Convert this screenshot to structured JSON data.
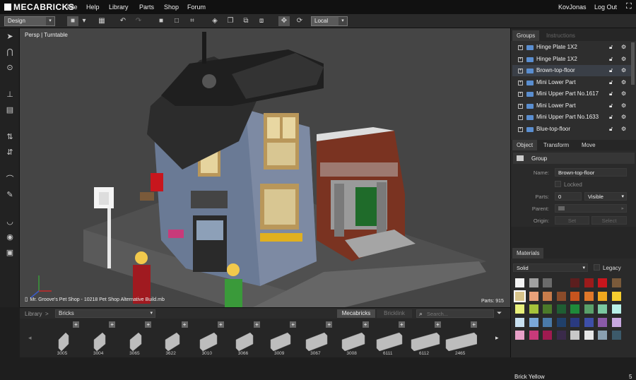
{
  "app": {
    "logo": "MECABRICKS",
    "user": "KovJonas",
    "logout": "Log Out"
  },
  "nav": [
    "File",
    "Help",
    "Library",
    "Parts",
    "Shop",
    "Forum"
  ],
  "toolbar": {
    "mode": "Design",
    "space": "Local"
  },
  "viewport": {
    "label": "Persp | Turntable",
    "file_title": "Mr. Groove's Pet Shop - 10218 Pet Shop Alternative Build.mb",
    "parts_count": "Parts: 915"
  },
  "library": {
    "crumb_root": "Library",
    "crumb_sep": ">",
    "category": "Bricks",
    "source_a": "Mecabricks",
    "source_b": "Bricklink",
    "search_placeholder": "Search..."
  },
  "bricks": [
    {
      "id": "3005"
    },
    {
      "id": "3004"
    },
    {
      "id": "3065"
    },
    {
      "id": "3622"
    },
    {
      "id": "3010"
    },
    {
      "id": "3066"
    },
    {
      "id": "3009"
    },
    {
      "id": "3067"
    },
    {
      "id": "3008"
    },
    {
      "id": "6111"
    },
    {
      "id": "6112"
    },
    {
      "id": "2465"
    }
  ],
  "brick_plus": "+",
  "panel": {
    "tabs": [
      "Groups",
      "Instructions"
    ],
    "groups": [
      {
        "name": "Hinge Plate 1X2"
      },
      {
        "name": "Hinge Plate 1X2"
      },
      {
        "name": "Brown-top-floor"
      },
      {
        "name": "Mini Lower Part"
      },
      {
        "name": "Mini Upper Part No.1617"
      },
      {
        "name": "Mini Lower Part"
      },
      {
        "name": "Mini Upper Part No.1633"
      },
      {
        "name": "Blue-top-floor"
      }
    ],
    "obj_tabs": [
      "Object",
      "Transform",
      "Move"
    ],
    "object": {
      "type": "Group",
      "name_label": "Name:",
      "name_value": "Brown-top-floor",
      "locked_label": "Locked",
      "parts_label": "Parts:",
      "parts_value": "0",
      "visibility": "Visible",
      "parent_label": "Parent:",
      "origin_label": "Origin:",
      "origin_set": "Set",
      "origin_select": "Select"
    },
    "materials_tab": "Materials",
    "material_type": "Solid",
    "legacy_label": "Legacy",
    "selected_color": "Brick Yellow",
    "selected_count": "5",
    "swatches": [
      "#f2f2f2",
      "#a0a0a0",
      "#6b6b6b",
      "#2a2a2a",
      "#5c1e1e",
      "#9b1b1b",
      "#c8161d",
      "#7a5a3a",
      "#d8c48a",
      "#e8a07a",
      "#c77c4b",
      "#8a4b2a",
      "#c8541e",
      "#e0782a",
      "#f0a81e",
      "#f5cd2f",
      "#e8f07a",
      "#a6c23a",
      "#4b7a2a",
      "#1f5e33",
      "#1f8a3a",
      "#5aa06a",
      "#7ac8a0",
      "#b8f0e8",
      "#c8e0f0",
      "#7aa8d8",
      "#4a7aa8",
      "#20406a",
      "#2a3a80",
      "#3e4fa8",
      "#8a5aa8",
      "#c8a8e0",
      "#e8a0c8",
      "#c83a7a",
      "#a01a50",
      "#3a2a4a",
      "#c8c8c8",
      "#e6e6e6",
      "#8aa0b0",
      "#3c5a6a"
    ]
  }
}
